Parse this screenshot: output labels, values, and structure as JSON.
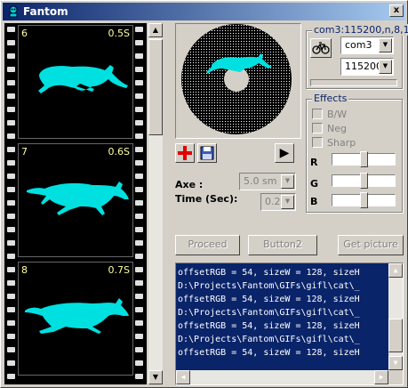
{
  "window": {
    "title": "Fantom",
    "close_glyph": "x"
  },
  "film": {
    "frames": [
      {
        "num": "6",
        "time": "0.5S"
      },
      {
        "num": "7",
        "time": "0.6S"
      },
      {
        "num": "8",
        "time": "0.7S"
      }
    ],
    "figure_color": "#00e0e0"
  },
  "preview": {
    "play_glyph": "▶"
  },
  "axe": {
    "label": "Axe :",
    "value": "5.0 sm"
  },
  "time": {
    "label": "Time (Sec):",
    "value": "0.2"
  },
  "serial": {
    "title": "com3:115200,n,8,1",
    "port": "com3",
    "baud": "115200",
    "bike_icon": "bicycle-icon"
  },
  "effects": {
    "title": "Effects",
    "checks": [
      "B/W",
      "Neg",
      "Sharp"
    ],
    "sliders": [
      {
        "label": "R",
        "level": 0.5
      },
      {
        "label": "G",
        "level": 0.5
      },
      {
        "label": "B",
        "level": 0.5
      }
    ]
  },
  "buttons": {
    "proceed": "Proceed",
    "button2": "Button2",
    "get_picture": "Get picture"
  },
  "log": {
    "lines": [
      "offsetRGB = 54, sizeW = 128, sizeH",
      "D:\\Projects\\Fantom\\GIFs\\gifl\\cat\\_",
      "offsetRGB = 54, sizeW = 128, sizeH",
      "D:\\Projects\\Fantom\\GIFs\\gifl\\cat\\_",
      "offsetRGB = 54, sizeW = 128, sizeH",
      "D:\\Projects\\Fantom\\GIFs\\gifl\\cat\\_",
      "offsetRGB = 54, sizeW = 128, sizeH"
    ],
    "colors": {
      "background": "#0a246a",
      "text": "#ffffff"
    }
  },
  "colors": {
    "accent": "#0a246a",
    "add_icon": "#e00000"
  }
}
